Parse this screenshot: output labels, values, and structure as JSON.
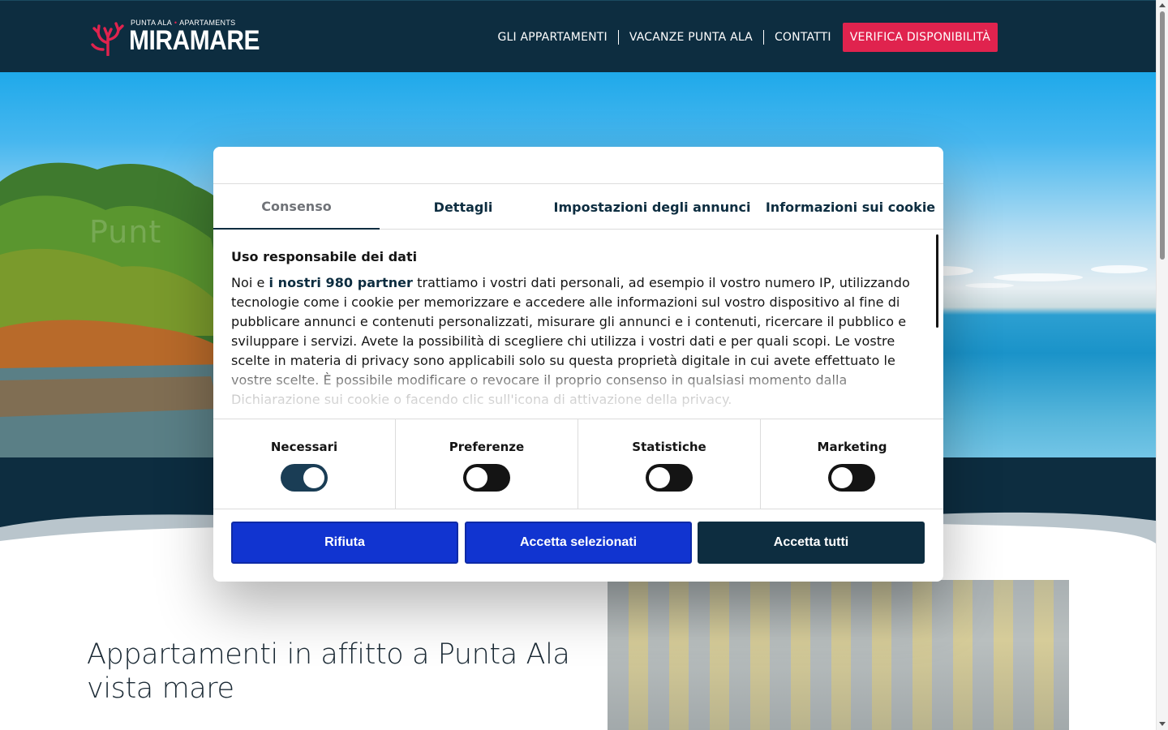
{
  "header": {
    "logo": {
      "top_left": "PUNTA ALA",
      "top_right": "APARTAMENTS",
      "brand": "MIRAMARE"
    },
    "nav": [
      {
        "label": "GLI APPARTAMENTI"
      },
      {
        "label": "VACANZE PUNTA ALA"
      },
      {
        "label": "CONTATTI"
      }
    ],
    "cta_label": "VERIFICA DISPONIBILITÀ"
  },
  "hero": {
    "faint_text": "Punt"
  },
  "main": {
    "title": "Appartamenti in affitto a Punta Ala vista mare"
  },
  "cookie_dialog": {
    "tabs": [
      {
        "label": "Consenso",
        "active": true
      },
      {
        "label": "Dettagli",
        "active": false
      },
      {
        "label": "Impostazioni degli annunci",
        "active": false
      },
      {
        "label": "Informazioni sui cookie",
        "active": false
      }
    ],
    "heading": "Uso responsabile dei dati",
    "text_before_link": "Noi e ",
    "link_text": "i nostri 980 partner",
    "text_after_link": " trattiamo i vostri dati personali, ad esempio il vostro numero IP, utilizzando tecnologie come i cookie per memorizzare e accedere alle informazioni sul vostro dispositivo al fine di pubblicare annunci e contenuti personalizzati, misurare gli annunci e i contenuti, ricercare il pubblico e sviluppare i servizi. Avete la possibilità di scegliere chi utilizza i vostri dati e per quali scopi. Le vostre scelte in materia di privacy sono applicabili solo su questa proprietà digitale in cui avete effettuato le vostre scelte. È possibile modificare o revocare il proprio consenso in qualsiasi momento dalla Dichiarazione sui cookie o facendo clic sull'icona di attivazione della privacy.",
    "categories": [
      {
        "label": "Necessari",
        "enabled": true
      },
      {
        "label": "Preferenze",
        "enabled": false
      },
      {
        "label": "Statistiche",
        "enabled": false
      },
      {
        "label": "Marketing",
        "enabled": false
      }
    ],
    "buttons": {
      "reject": "Rifiuta",
      "accept_selected": "Accetta selezionati",
      "accept_all": "Accetta tutti"
    }
  },
  "colors": {
    "navy": "#0d2d40",
    "accent_red": "#e0234e",
    "button_blue": "#1134d0"
  }
}
